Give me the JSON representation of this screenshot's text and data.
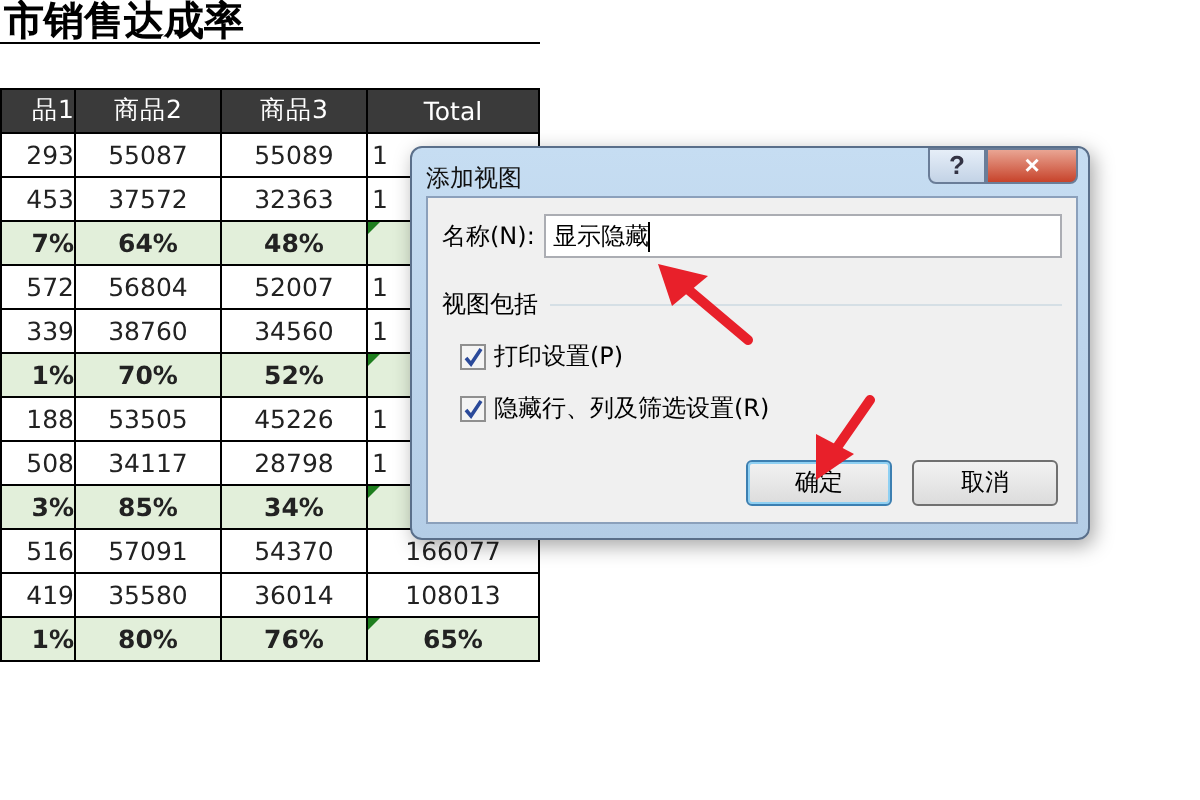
{
  "sheet": {
    "title": "市销售达成率",
    "columns": [
      "品1",
      "商品2",
      "商品3",
      "Total"
    ],
    "rows": [
      {
        "kind": "value",
        "cells": [
          {
            "text": "293"
          },
          {
            "text": "55087"
          },
          {
            "text": "55089"
          },
          {
            "text": "1",
            "cut": true
          }
        ]
      },
      {
        "kind": "value",
        "cells": [
          {
            "text": "453"
          },
          {
            "text": "37572"
          },
          {
            "text": "32363"
          },
          {
            "text": "1",
            "cut": true
          }
        ]
      },
      {
        "kind": "rate",
        "cells": [
          {
            "text": "7%"
          },
          {
            "text": "64%"
          },
          {
            "text": "48%"
          },
          {}
        ]
      },
      {
        "kind": "value",
        "cells": [
          {
            "text": "572"
          },
          {
            "text": "56804"
          },
          {
            "text": "52007"
          },
          {
            "text": "1",
            "cut": true
          }
        ]
      },
      {
        "kind": "value",
        "cells": [
          {
            "text": "339"
          },
          {
            "text": "38760"
          },
          {
            "text": "34560"
          },
          {
            "text": "1",
            "cut": true
          }
        ]
      },
      {
        "kind": "rate",
        "cells": [
          {
            "text": "1%"
          },
          {
            "text": "70%"
          },
          {
            "text": "52%"
          },
          {}
        ]
      },
      {
        "kind": "value",
        "cells": [
          {
            "text": "188"
          },
          {
            "text": "53505"
          },
          {
            "text": "45226"
          },
          {
            "text": "1",
            "cut": true
          }
        ]
      },
      {
        "kind": "value",
        "cells": [
          {
            "text": "508"
          },
          {
            "text": "34117"
          },
          {
            "text": "28798"
          },
          {
            "text": "1",
            "cut": true
          }
        ]
      },
      {
        "kind": "rate",
        "cells": [
          {
            "text": "3%"
          },
          {
            "text": "85%"
          },
          {
            "text": "34%"
          },
          {}
        ]
      },
      {
        "kind": "value",
        "cells": [
          {
            "text": "516"
          },
          {
            "text": "57091"
          },
          {
            "text": "54370"
          },
          {
            "text": "166077",
            "cut": false
          }
        ]
      },
      {
        "kind": "value",
        "cells": [
          {
            "text": "419"
          },
          {
            "text": "35580"
          },
          {
            "text": "36014"
          },
          {
            "text": "108013",
            "cut": false
          }
        ]
      },
      {
        "kind": "rate",
        "cells": [
          {
            "text": "1%"
          },
          {
            "text": "80%"
          },
          {
            "text": "76%"
          },
          {
            "text": "65%",
            "cut": false
          }
        ]
      }
    ]
  },
  "dialog": {
    "title": "添加视图",
    "help": "?",
    "close": "×",
    "name_label": "名称(N):",
    "name_value": "显示隐藏",
    "group_label": "视图包括",
    "options": [
      {
        "label": "打印设置(P)",
        "checked": true
      },
      {
        "label": "隐藏行、列及筛选设置(R)",
        "checked": true
      }
    ],
    "buttons": [
      {
        "label": "确定",
        "selected": true
      },
      {
        "label": "取消",
        "selected": false
      }
    ]
  }
}
